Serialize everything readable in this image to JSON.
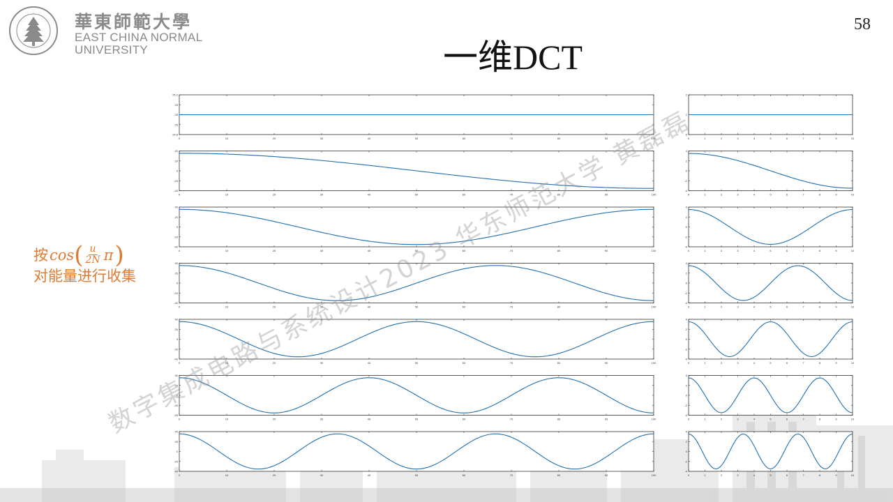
{
  "header": {
    "logo_cn": "華東師範大學",
    "logo_en_line1": "EAST CHINA NORMAL",
    "logo_en_line2": "UNIVERSITY",
    "page_number": "58"
  },
  "slide": {
    "title": "一维DCT",
    "note_prefix": "按",
    "note_cos": "cos",
    "note_frac_num": "u",
    "note_frac_den": "2N",
    "note_pi": "π",
    "note_line2": "对能量进行收集"
  },
  "watermark": "数字集成电路与系统设计2023 华东师范大学 黄磊磊",
  "colors": {
    "line": "#1f6fb2",
    "note": "#e07a30",
    "text_gray": "#8a8a8a"
  },
  "chart_data": [
    {
      "type": "line",
      "description_role": "left column: 7 DCT cosine basis functions (u = 0..6), N = 100 samples",
      "x_range": [
        0,
        100
      ],
      "x_ticks": [
        "0",
        "10",
        "20",
        "30",
        "40",
        "50",
        "60",
        "70",
        "80",
        "90",
        "100"
      ],
      "series": [
        {
          "u": 0,
          "y_range": [
            24.8,
            25.2
          ],
          "y_ticks": [
            "25.2",
            "25",
            "25",
            "25",
            "24.8"
          ],
          "constant": 25
        },
        {
          "u": 1,
          "y_range": [
            -40,
            40
          ],
          "y_ticks": [
            "40",
            "20",
            "0",
            "-20",
            "-40"
          ],
          "amplitude": 35.4
        },
        {
          "u": 2,
          "y_range": [
            -40,
            40
          ],
          "y_ticks": [
            "40",
            "20",
            "0",
            "-20",
            "-40"
          ],
          "amplitude": 35.4
        },
        {
          "u": 3,
          "y_range": [
            -40,
            40
          ],
          "y_ticks": [
            "40",
            "20",
            "0",
            "-20",
            "-40"
          ],
          "amplitude": 35.4
        },
        {
          "u": 4,
          "y_range": [
            -40,
            40
          ],
          "y_ticks": [
            "40",
            "20",
            "0",
            "-20",
            "-40"
          ],
          "amplitude": 35.4
        },
        {
          "u": 5,
          "y_range": [
            -40,
            40
          ],
          "y_ticks": [
            "40",
            "20",
            "0",
            "-20",
            "-40"
          ],
          "amplitude": 35.4
        },
        {
          "u": 6,
          "y_range": [
            -40,
            40
          ],
          "y_ticks": [
            "40",
            "20",
            "0",
            "-20",
            "-40"
          ],
          "amplitude": 35.4
        }
      ]
    },
    {
      "type": "line",
      "description_role": "right column: same 7 basis functions, N = 10 samples",
      "x_range": [
        0,
        10
      ],
      "x_ticks": [
        "0",
        "1",
        "2",
        "3",
        "4",
        "5",
        "6",
        "7",
        "8",
        "9",
        "10"
      ],
      "series": [
        {
          "u": 0,
          "y_range": [
            0,
            2
          ],
          "y_ticks": [
            "2",
            "1",
            "0"
          ],
          "constant": 1
        },
        {
          "u": 1,
          "y_range": [
            -4,
            4
          ],
          "y_ticks": [
            "4",
            "2",
            "0",
            "-2",
            "-4"
          ],
          "amplitude": 3.5
        },
        {
          "u": 2,
          "y_range": [
            -4,
            4
          ],
          "y_ticks": [
            "4",
            "2",
            "0",
            "-2",
            "-4"
          ],
          "amplitude": 3.5
        },
        {
          "u": 3,
          "y_range": [
            -4,
            4
          ],
          "y_ticks": [
            "4",
            "2",
            "0",
            "-2",
            "-4"
          ],
          "amplitude": 3.5
        },
        {
          "u": 4,
          "y_range": [
            -4,
            4
          ],
          "y_ticks": [
            "4",
            "2",
            "0",
            "-2",
            "-4"
          ],
          "amplitude": 3.5
        },
        {
          "u": 5,
          "y_range": [
            -4,
            4
          ],
          "y_ticks": [
            "4",
            "2",
            "0",
            "-2",
            "-4"
          ],
          "amplitude": 3.5
        },
        {
          "u": 6,
          "y_range": [
            -4,
            4
          ],
          "y_ticks": [
            "4",
            "2",
            "0",
            "-2",
            "-4"
          ],
          "amplitude": 3.5
        }
      ]
    }
  ]
}
